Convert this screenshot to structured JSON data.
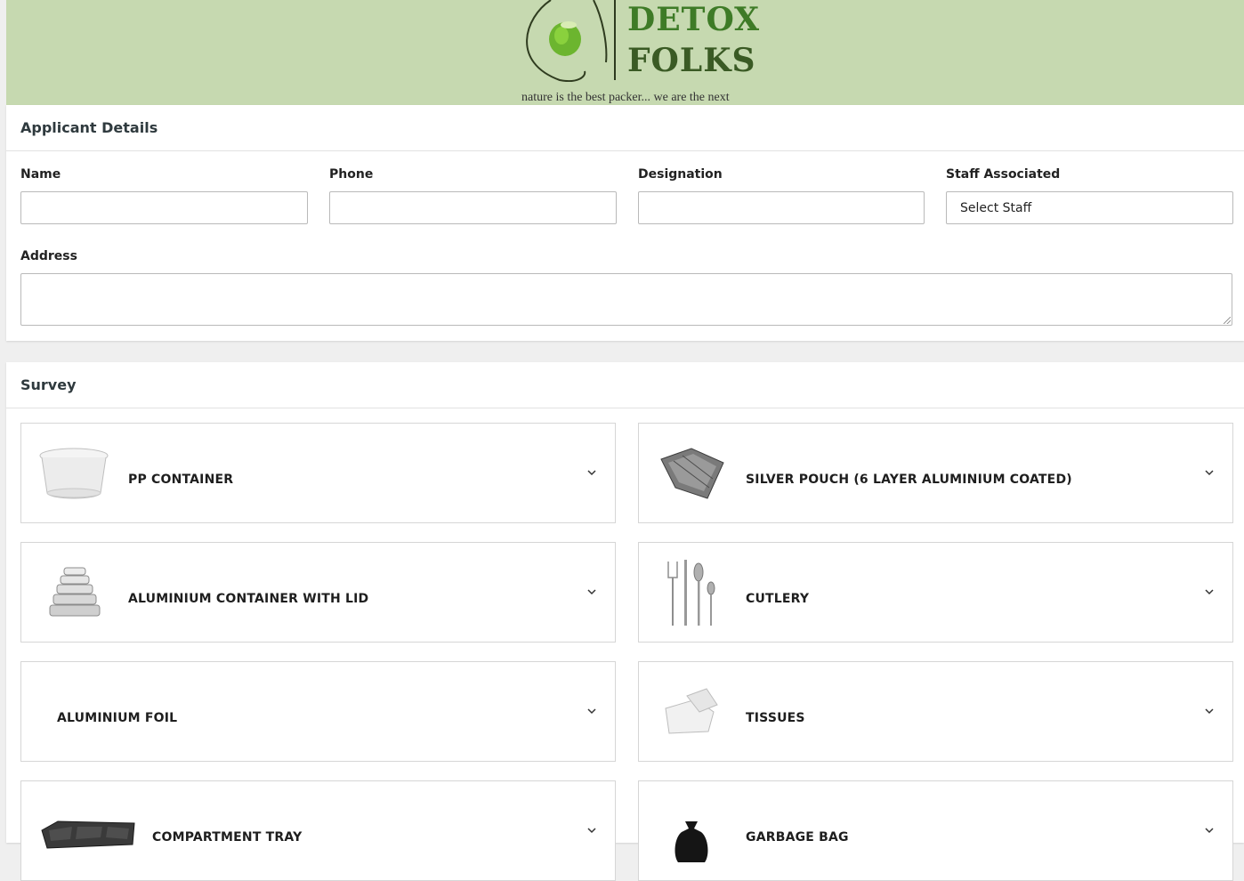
{
  "brand": {
    "line1": "DETOX",
    "line2": "FOLKS",
    "tagline": "nature is the best packer... we are the next",
    "colors": {
      "header_bg": "#c6d9b0",
      "brand_green": "#3e7b27"
    }
  },
  "applicant": {
    "title": "Applicant Details",
    "fields": {
      "name": {
        "label": "Name",
        "value": ""
      },
      "phone": {
        "label": "Phone",
        "value": ""
      },
      "designation": {
        "label": "Designation",
        "value": ""
      },
      "staff": {
        "label": "Staff Associated",
        "selected": "Select Staff"
      },
      "address": {
        "label": "Address",
        "value": ""
      }
    }
  },
  "survey": {
    "title": "Survey",
    "items": [
      {
        "label": "PP CONTAINER",
        "icon": "pp-container-icon"
      },
      {
        "label": "SILVER POUCH (6 LAYER ALUMINIUM COATED)",
        "icon": "silver-pouch-icon"
      },
      {
        "label": "ALUMINIUM CONTAINER WITH LID",
        "icon": "aluminium-container-icon"
      },
      {
        "label": "CUTLERY",
        "icon": "cutlery-icon"
      },
      {
        "label": "ALUMINIUM FOIL",
        "icon": ""
      },
      {
        "label": "TISSUES",
        "icon": "tissues-icon"
      },
      {
        "label": "COMPARTMENT TRAY",
        "icon": "compartment-tray-icon"
      },
      {
        "label": "GARBAGE BAG",
        "icon": "garbage-bag-icon"
      }
    ]
  }
}
